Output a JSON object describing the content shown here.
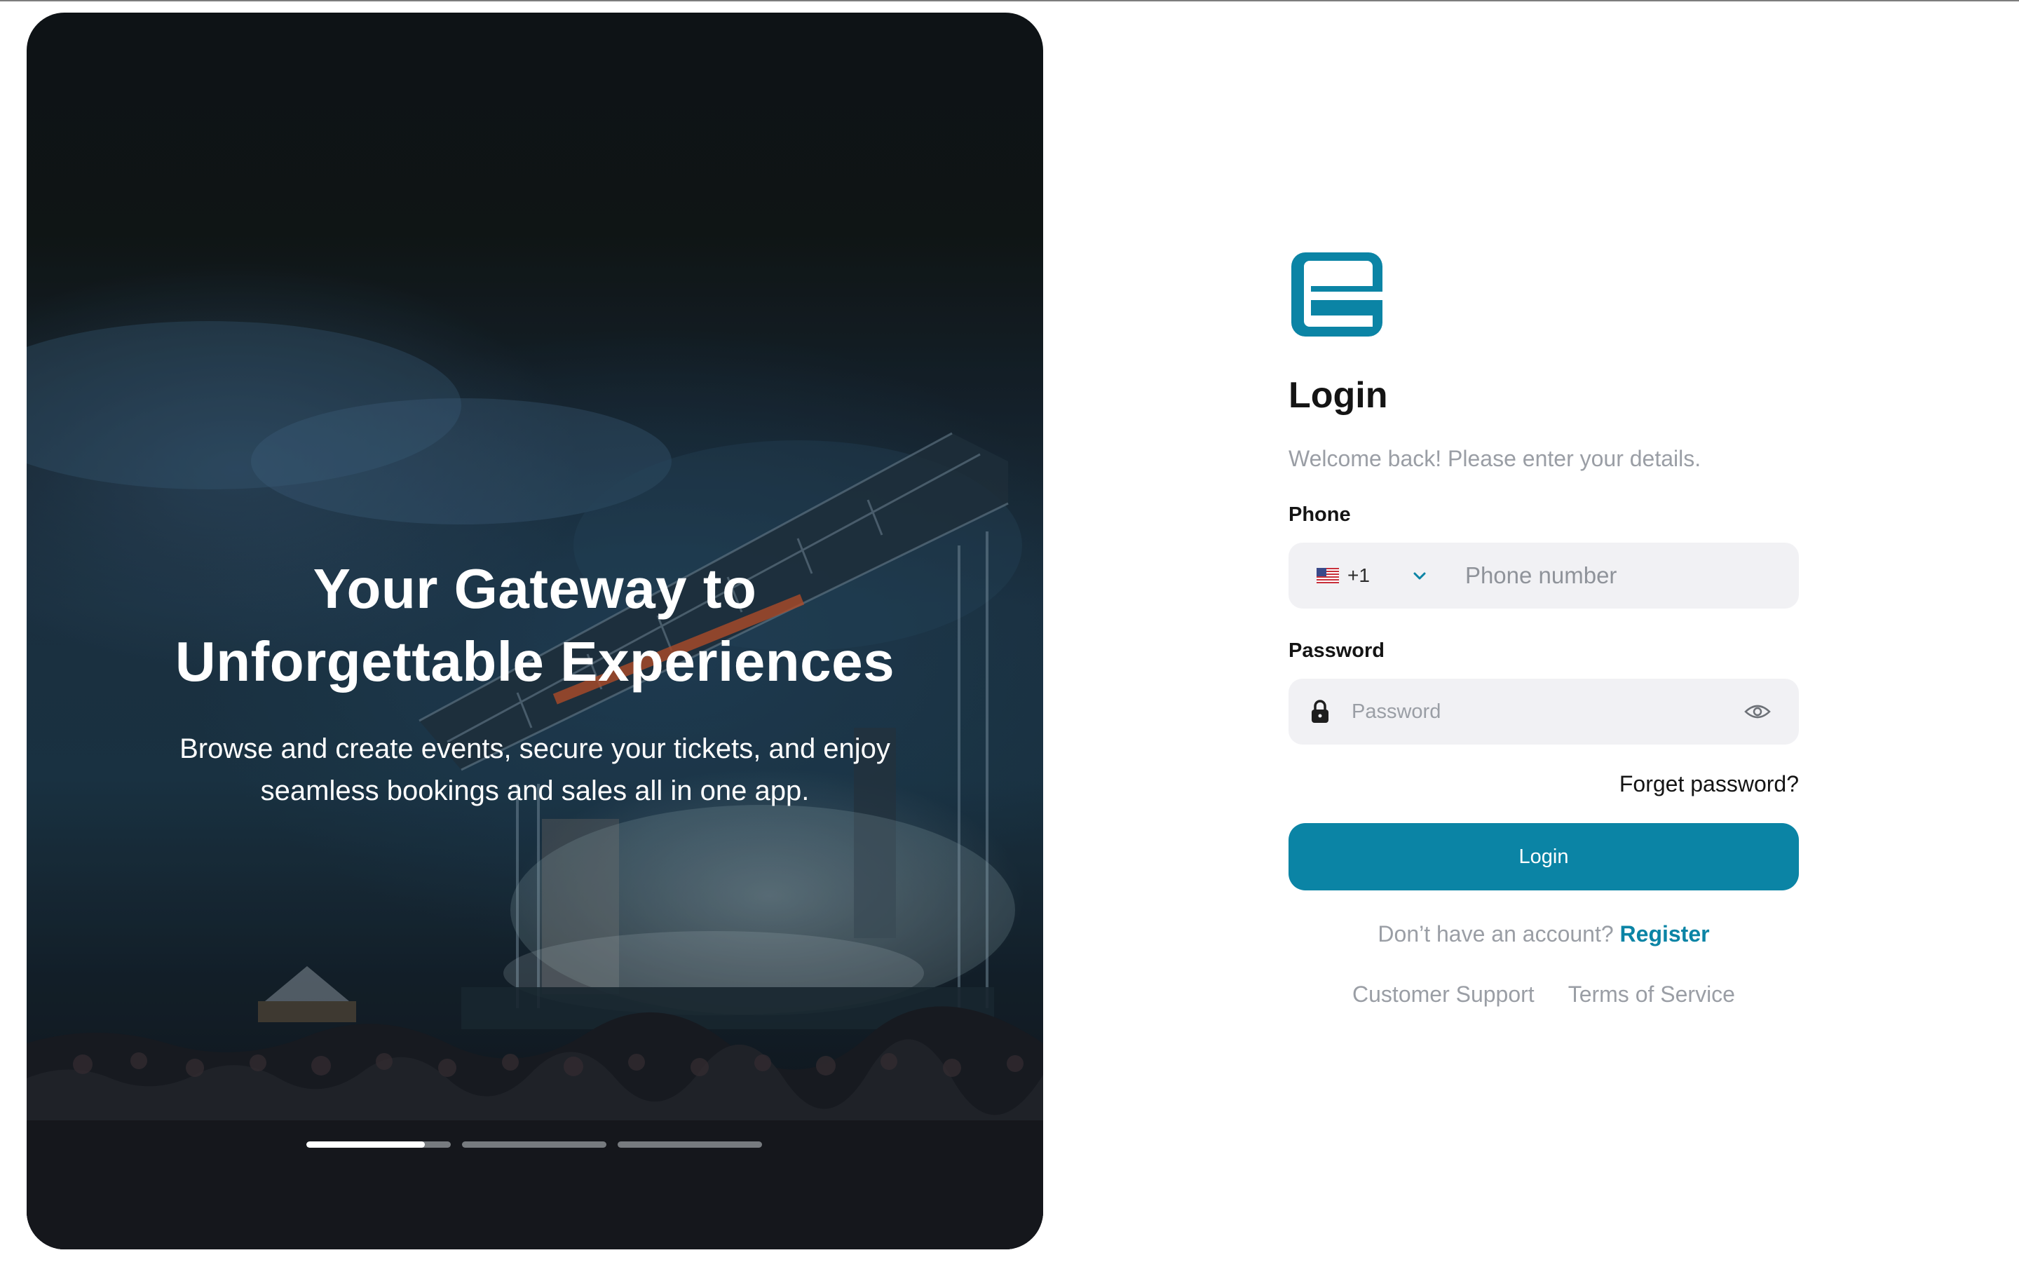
{
  "hero": {
    "title_line1": "Your Gateway to",
    "title_line2": "Unforgettable Experiences",
    "subtitle_line1": "Browse and create events, secure your tickets, and enjoy",
    "subtitle_line2": "seamless bookings and sales all in one app.",
    "carousel": {
      "slide_count": 3,
      "active_index": 0,
      "active_progress": 0.82
    }
  },
  "brand": {
    "logo_icon": "brand-e-logo-icon",
    "accent_color": "#0b84a5"
  },
  "login": {
    "title": "Login",
    "subtitle": "Welcome back! Please enter your details.",
    "phone": {
      "label": "Phone",
      "country_flag_icon": "us-flag-icon",
      "country_code": "+1",
      "placeholder": "Phone number",
      "value": ""
    },
    "password": {
      "label": "Password",
      "placeholder": "Password",
      "value": "",
      "leading_icon": "lock-icon",
      "toggle_icon": "eye-icon"
    },
    "forgot_label": "Forget password?",
    "submit_label": "Login",
    "register_prompt": "Don’t have an account?",
    "register_label": "Register"
  },
  "footer": {
    "support_label": "Customer Support",
    "terms_label": "Terms of Service"
  }
}
